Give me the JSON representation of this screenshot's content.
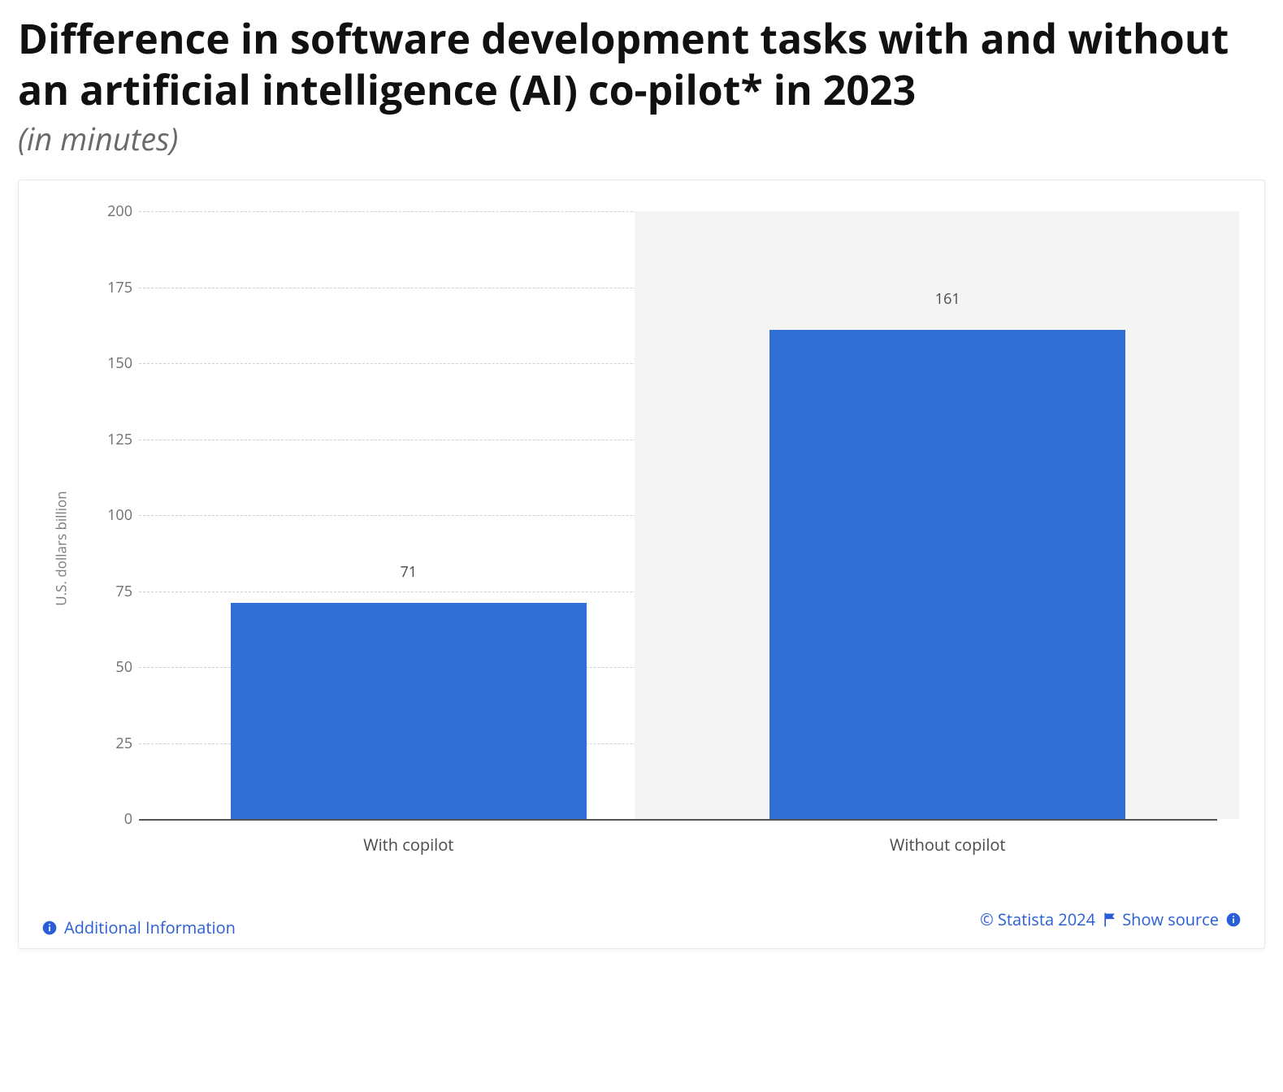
{
  "title": "Difference in software development tasks with and without an artificial intelligence (AI) co-pilot* in 2023",
  "subtitle": "(in minutes)",
  "footer": {
    "additional_info": "Additional Information",
    "copyright": "© Statista 2024",
    "show_source": "Show source"
  },
  "chart_data": {
    "type": "bar",
    "categories": [
      "With copilot",
      "Without copilot"
    ],
    "values": [
      71,
      161
    ],
    "title": "",
    "xlabel": "",
    "ylabel": "U.S. dollars billion",
    "ylim": [
      0,
      200
    ],
    "yticks": [
      0,
      25,
      50,
      75,
      100,
      125,
      150,
      175,
      200
    ]
  }
}
